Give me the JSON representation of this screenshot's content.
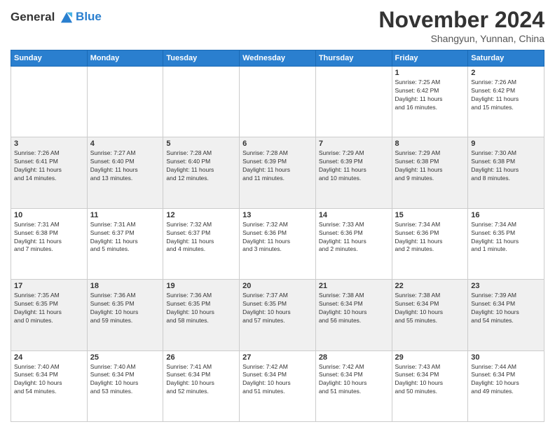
{
  "header": {
    "logo_line1": "General",
    "logo_line2": "Blue",
    "month": "November 2024",
    "location": "Shangyun, Yunnan, China"
  },
  "weekdays": [
    "Sunday",
    "Monday",
    "Tuesday",
    "Wednesday",
    "Thursday",
    "Friday",
    "Saturday"
  ],
  "weeks": [
    [
      {
        "day": "",
        "info": ""
      },
      {
        "day": "",
        "info": ""
      },
      {
        "day": "",
        "info": ""
      },
      {
        "day": "",
        "info": ""
      },
      {
        "day": "",
        "info": ""
      },
      {
        "day": "1",
        "info": "Sunrise: 7:25 AM\nSunset: 6:42 PM\nDaylight: 11 hours\nand 16 minutes."
      },
      {
        "day": "2",
        "info": "Sunrise: 7:26 AM\nSunset: 6:42 PM\nDaylight: 11 hours\nand 15 minutes."
      }
    ],
    [
      {
        "day": "3",
        "info": "Sunrise: 7:26 AM\nSunset: 6:41 PM\nDaylight: 11 hours\nand 14 minutes."
      },
      {
        "day": "4",
        "info": "Sunrise: 7:27 AM\nSunset: 6:40 PM\nDaylight: 11 hours\nand 13 minutes."
      },
      {
        "day": "5",
        "info": "Sunrise: 7:28 AM\nSunset: 6:40 PM\nDaylight: 11 hours\nand 12 minutes."
      },
      {
        "day": "6",
        "info": "Sunrise: 7:28 AM\nSunset: 6:39 PM\nDaylight: 11 hours\nand 11 minutes."
      },
      {
        "day": "7",
        "info": "Sunrise: 7:29 AM\nSunset: 6:39 PM\nDaylight: 11 hours\nand 10 minutes."
      },
      {
        "day": "8",
        "info": "Sunrise: 7:29 AM\nSunset: 6:38 PM\nDaylight: 11 hours\nand 9 minutes."
      },
      {
        "day": "9",
        "info": "Sunrise: 7:30 AM\nSunset: 6:38 PM\nDaylight: 11 hours\nand 8 minutes."
      }
    ],
    [
      {
        "day": "10",
        "info": "Sunrise: 7:31 AM\nSunset: 6:38 PM\nDaylight: 11 hours\nand 7 minutes."
      },
      {
        "day": "11",
        "info": "Sunrise: 7:31 AM\nSunset: 6:37 PM\nDaylight: 11 hours\nand 5 minutes."
      },
      {
        "day": "12",
        "info": "Sunrise: 7:32 AM\nSunset: 6:37 PM\nDaylight: 11 hours\nand 4 minutes."
      },
      {
        "day": "13",
        "info": "Sunrise: 7:32 AM\nSunset: 6:36 PM\nDaylight: 11 hours\nand 3 minutes."
      },
      {
        "day": "14",
        "info": "Sunrise: 7:33 AM\nSunset: 6:36 PM\nDaylight: 11 hours\nand 2 minutes."
      },
      {
        "day": "15",
        "info": "Sunrise: 7:34 AM\nSunset: 6:36 PM\nDaylight: 11 hours\nand 2 minutes."
      },
      {
        "day": "16",
        "info": "Sunrise: 7:34 AM\nSunset: 6:35 PM\nDaylight: 11 hours\nand 1 minute."
      }
    ],
    [
      {
        "day": "17",
        "info": "Sunrise: 7:35 AM\nSunset: 6:35 PM\nDaylight: 11 hours\nand 0 minutes."
      },
      {
        "day": "18",
        "info": "Sunrise: 7:36 AM\nSunset: 6:35 PM\nDaylight: 10 hours\nand 59 minutes."
      },
      {
        "day": "19",
        "info": "Sunrise: 7:36 AM\nSunset: 6:35 PM\nDaylight: 10 hours\nand 58 minutes."
      },
      {
        "day": "20",
        "info": "Sunrise: 7:37 AM\nSunset: 6:35 PM\nDaylight: 10 hours\nand 57 minutes."
      },
      {
        "day": "21",
        "info": "Sunrise: 7:38 AM\nSunset: 6:34 PM\nDaylight: 10 hours\nand 56 minutes."
      },
      {
        "day": "22",
        "info": "Sunrise: 7:38 AM\nSunset: 6:34 PM\nDaylight: 10 hours\nand 55 minutes."
      },
      {
        "day": "23",
        "info": "Sunrise: 7:39 AM\nSunset: 6:34 PM\nDaylight: 10 hours\nand 54 minutes."
      }
    ],
    [
      {
        "day": "24",
        "info": "Sunrise: 7:40 AM\nSunset: 6:34 PM\nDaylight: 10 hours\nand 54 minutes."
      },
      {
        "day": "25",
        "info": "Sunrise: 7:40 AM\nSunset: 6:34 PM\nDaylight: 10 hours\nand 53 minutes."
      },
      {
        "day": "26",
        "info": "Sunrise: 7:41 AM\nSunset: 6:34 PM\nDaylight: 10 hours\nand 52 minutes."
      },
      {
        "day": "27",
        "info": "Sunrise: 7:42 AM\nSunset: 6:34 PM\nDaylight: 10 hours\nand 51 minutes."
      },
      {
        "day": "28",
        "info": "Sunrise: 7:42 AM\nSunset: 6:34 PM\nDaylight: 10 hours\nand 51 minutes."
      },
      {
        "day": "29",
        "info": "Sunrise: 7:43 AM\nSunset: 6:34 PM\nDaylight: 10 hours\nand 50 minutes."
      },
      {
        "day": "30",
        "info": "Sunrise: 7:44 AM\nSunset: 6:34 PM\nDaylight: 10 hours\nand 49 minutes."
      }
    ]
  ]
}
